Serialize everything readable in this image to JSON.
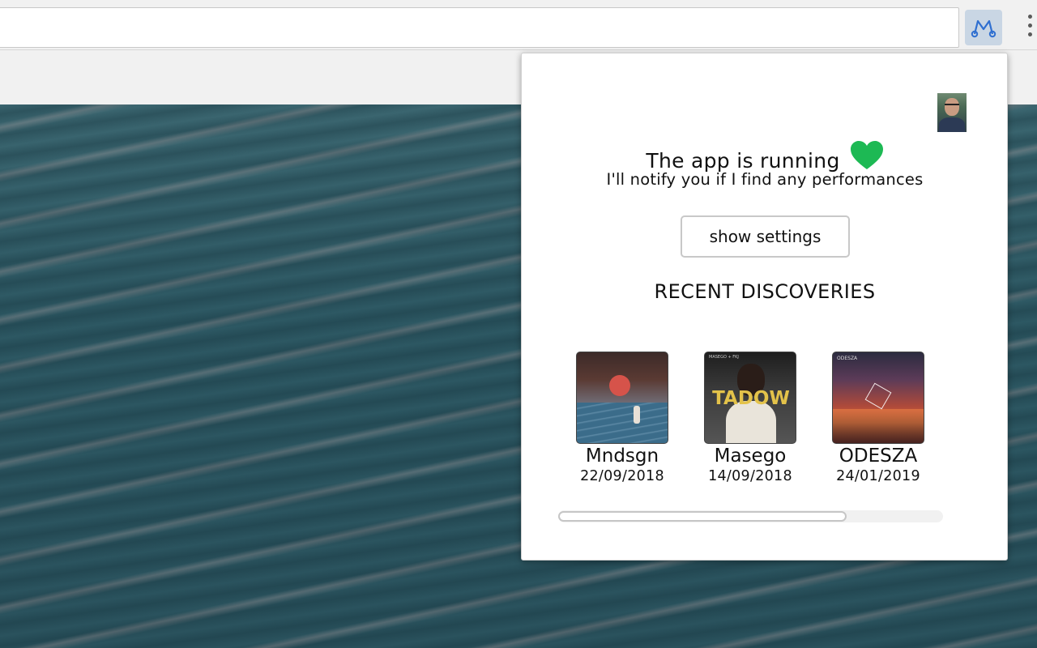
{
  "browser": {
    "address_value": "",
    "extension_icon": "music-note-icon",
    "menu_icon": "more-vertical-icon"
  },
  "popup": {
    "status_title": "The app is running",
    "status_subtitle": "I'll notify you if I find any performances",
    "status_icon": "heart-icon",
    "status_color": "#1db954",
    "settings_label": "show settings",
    "section_title": "RECENT DISCOVERIES",
    "discoveries": [
      {
        "artist": "Mndsgn",
        "date": "22/09/2018",
        "cover_icon": "album-cover-image"
      },
      {
        "artist": "Masego",
        "date": "14/09/2018",
        "cover_icon": "album-cover-image",
        "cover_text": "TADOW",
        "cover_small_text": "MASEGO + FKJ"
      },
      {
        "artist": "ODESZA",
        "date": "24/01/2019",
        "cover_icon": "album-cover-image",
        "cover_small_text": "ODESZA"
      }
    ],
    "scroll_fraction": 0.75
  }
}
